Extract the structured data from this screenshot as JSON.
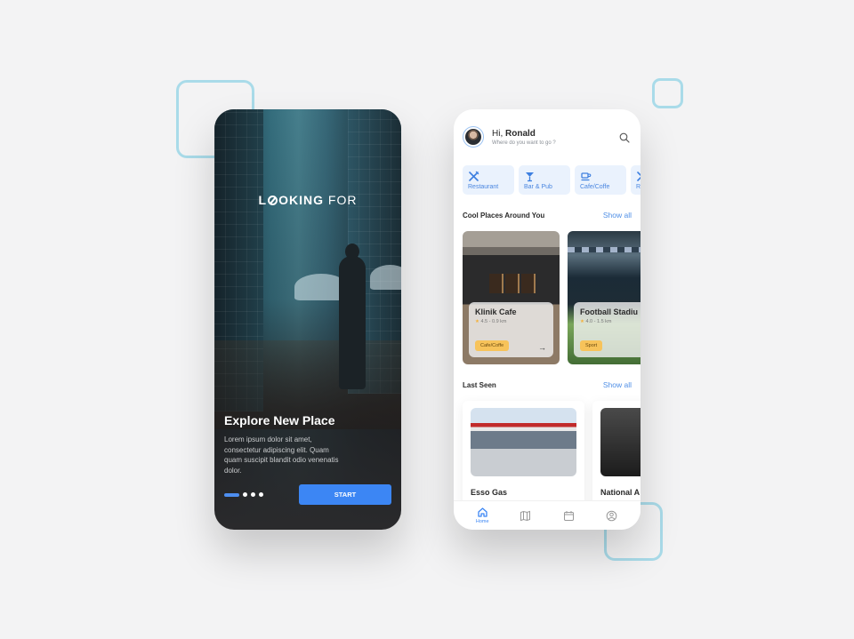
{
  "splash": {
    "logo_bold": "L",
    "logo_rest_bold": "OKING",
    "logo_thin": "FOR",
    "title": "Explore New Place",
    "body": "Lorem ipsum dolor sit amet, consectetur adipiscing elit. Quam quam suscipit blandit odio venenatis dolor.",
    "pagination": {
      "total": 4,
      "active": 1
    },
    "start_label": "START",
    "accent": "#3c86f4"
  },
  "home": {
    "greeting_prefix": "Hi,",
    "user_name": "Ronald",
    "subtitle": "Where do you want to go ?",
    "categories": [
      {
        "label": "Restaurant",
        "icon": "fork-knife-icon"
      },
      {
        "label": "Bar & Pub",
        "icon": "cocktail-icon"
      },
      {
        "label": "Cafe/Coffe",
        "icon": "coffee-cup-icon"
      },
      {
        "label": "R",
        "icon": "fork-knife-icon"
      }
    ],
    "cool_places": {
      "title": "Cool Places Around You",
      "show_all": "Show all",
      "items": [
        {
          "name": "Klinik Cafe",
          "rating": "4.5",
          "distance": "0.9 km",
          "meta": "4.5 - 0.9 km",
          "tag": "Cafe/Coffe"
        },
        {
          "name": "Football Stadiu",
          "rating": "4.0",
          "distance": "1.5 km",
          "meta": "4.0 - 1.5 km",
          "tag": "Sport"
        }
      ]
    },
    "last_seen": {
      "title": "Last Seen",
      "show_all": "Show all",
      "items": [
        {
          "name": "Esso Gas"
        },
        {
          "name": "National A"
        }
      ]
    },
    "nav": [
      {
        "label": "Home",
        "icon": "home-icon",
        "active": true
      },
      {
        "label": "",
        "icon": "map-icon",
        "active": false
      },
      {
        "label": "",
        "icon": "calendar-icon",
        "active": false
      },
      {
        "label": "",
        "icon": "profile-icon",
        "active": false
      }
    ]
  },
  "colors": {
    "accent": "#3c86f4",
    "tag": "#f7c35a",
    "category_bg": "#eaf2fd",
    "decor_outline": "#a9dbe9"
  }
}
